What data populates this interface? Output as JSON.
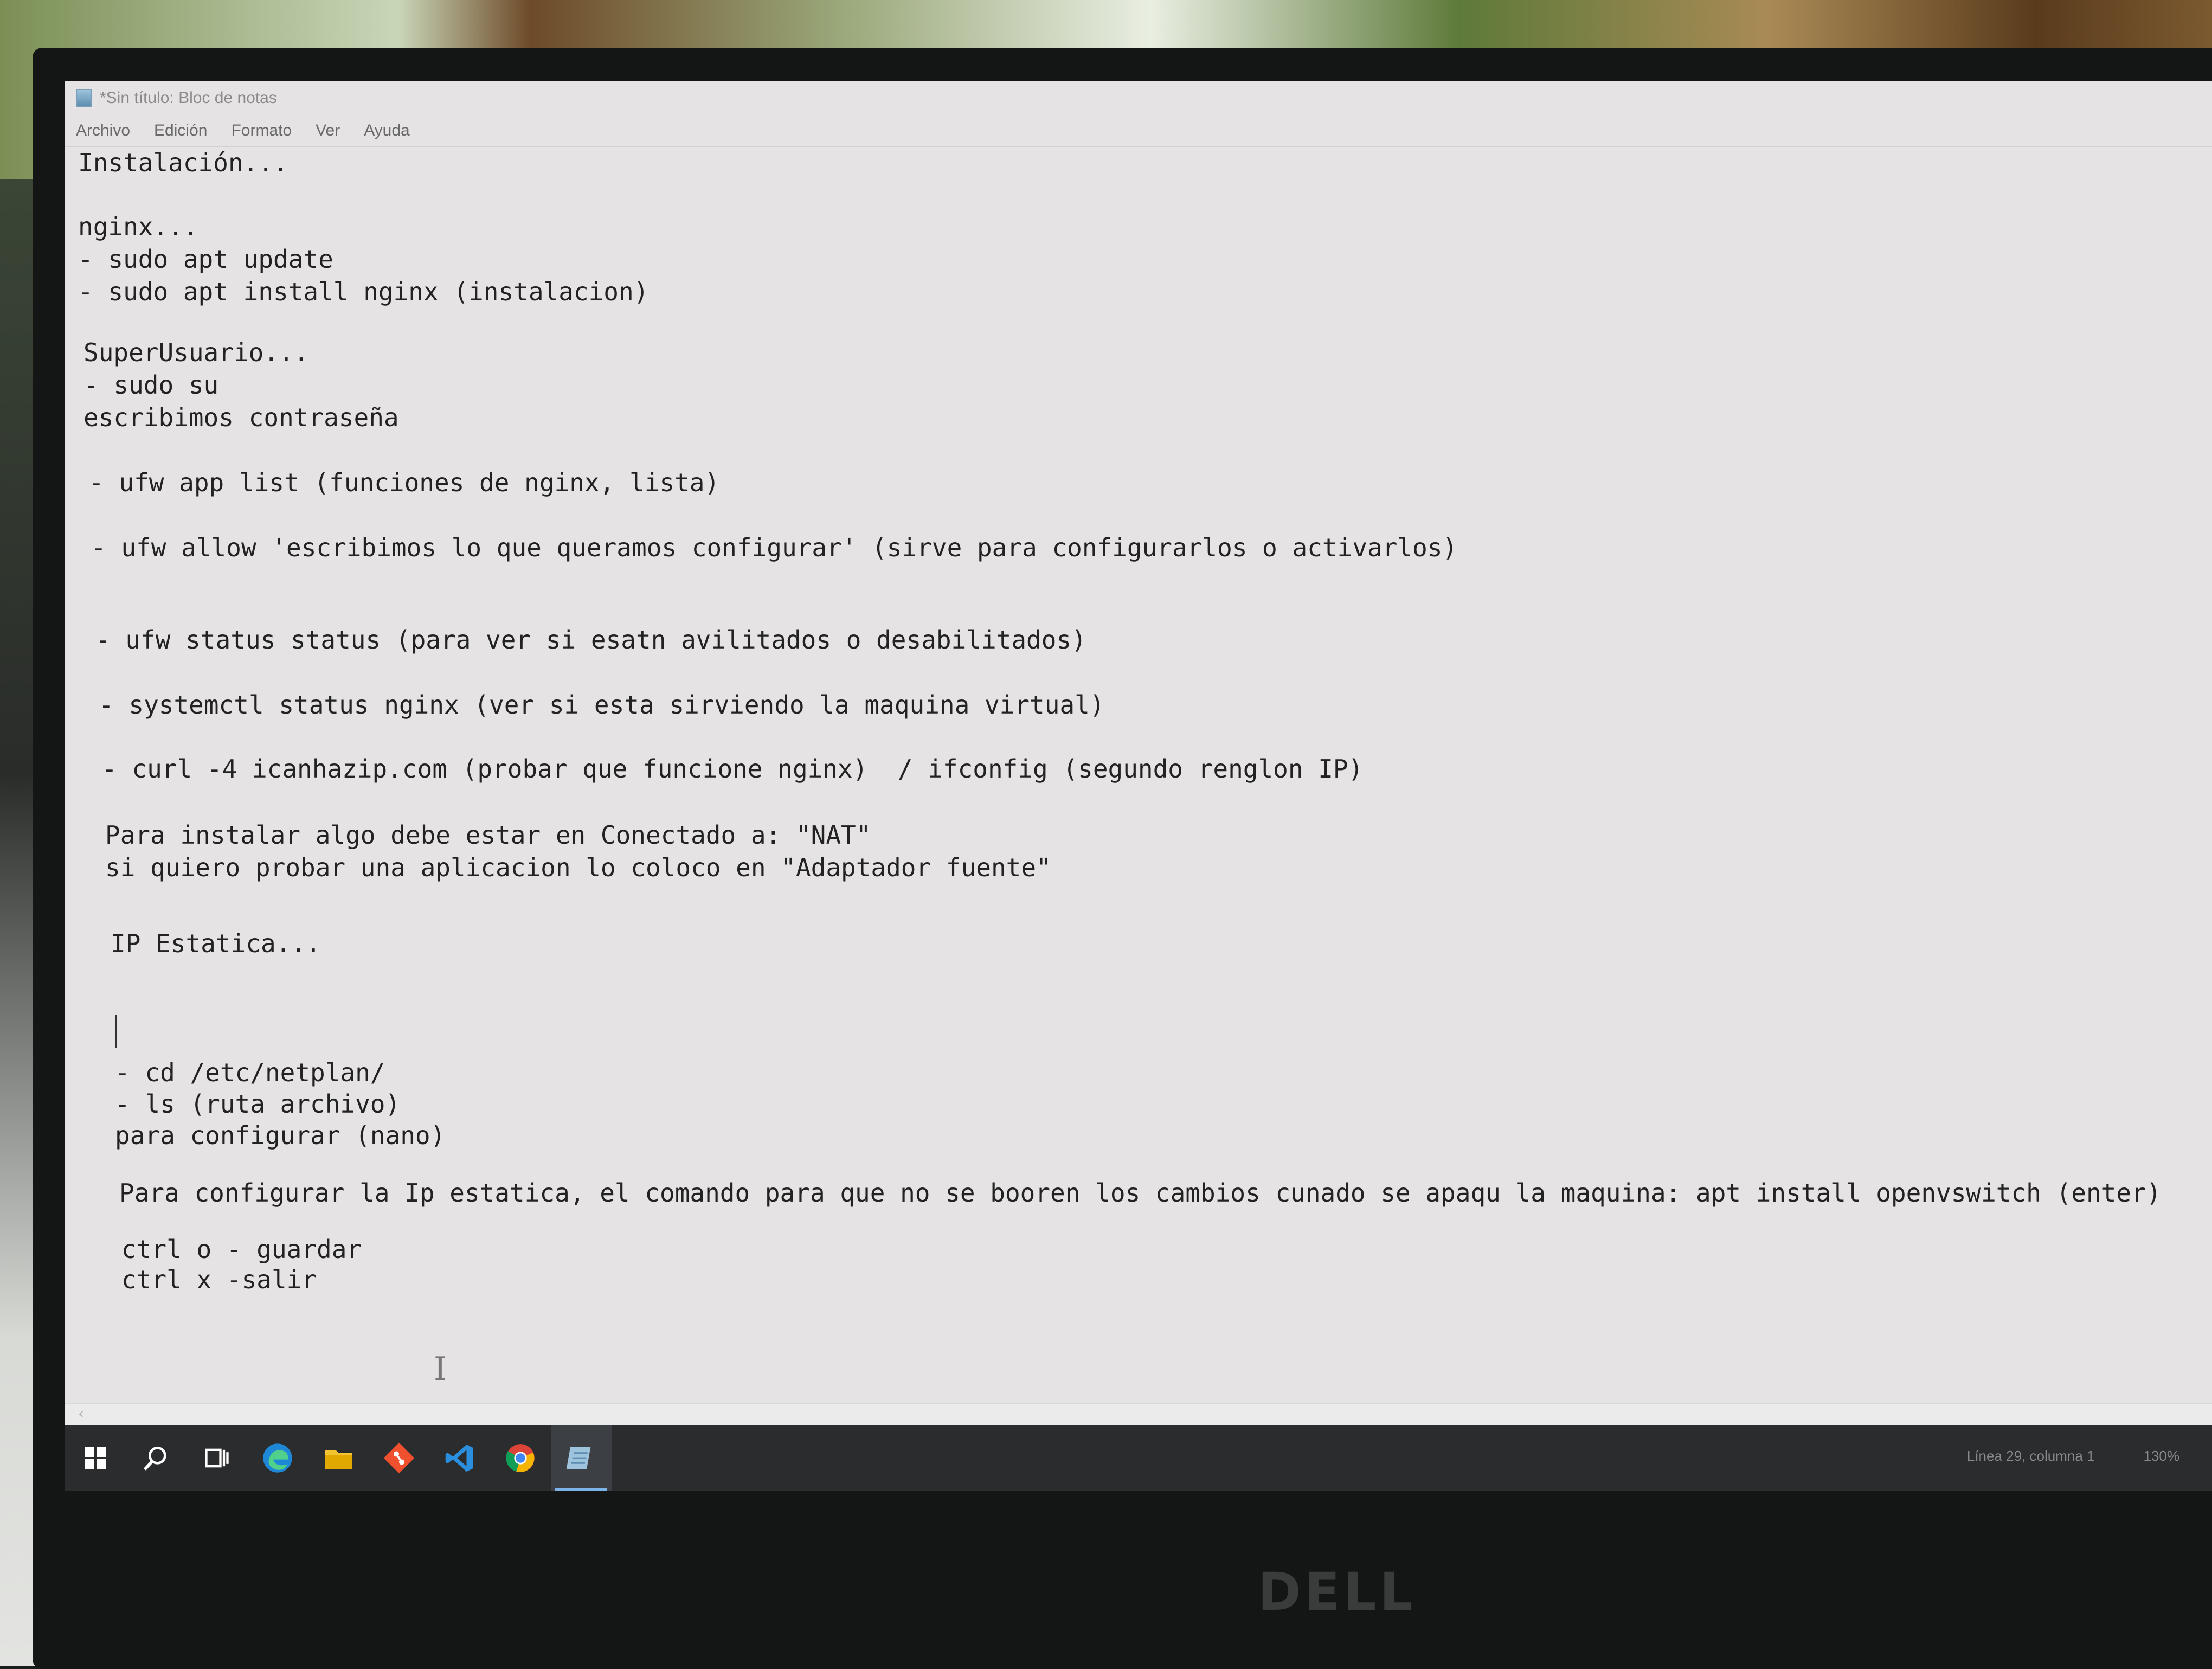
{
  "window": {
    "title": "*Sin título: Bloc de notas",
    "menu": [
      "Archivo",
      "Edición",
      "Formato",
      "Ver",
      "Ayuda"
    ]
  },
  "editor": {
    "lines": [
      "Instalación...",
      "nginx...",
      "- sudo apt update",
      "- sudo apt install nginx (instalacion)",
      "SuperUsuario...",
      "- sudo su",
      "escribimos contraseña",
      "- ufw app list (funciones de nginx, lista)",
      "- ufw allow 'escribimos lo que queramos configurar' (sirve para configurarlos o activarlos)",
      "- ufw status status (para ver si esatn avilitados o desabilitados)",
      "- systemctl status nginx (ver si esta sirviendo la maquina virtual)",
      "- curl -4 icanhazip.com (probar que funcione nginx)  / ifconfig (segundo renglon IP)",
      "Para instalar algo debe estar en Conectado a: \"NAT\"",
      "si quiero probar una aplicacion lo coloco en \"Adaptador fuente\"",
      "IP Estatica...",
      "- cd /etc/netplan/",
      "- ls (ruta archivo)",
      "para configurar (nano)",
      "Para configurar la Ip estatica, el comando para que no se booren los cambios cunado se apaqu la maquina: apt install openvswitch (enter)",
      "ctrl o - guardar",
      "ctrl x -salir"
    ]
  },
  "statusbar": {
    "position": "Línea 29, columna 1",
    "zoom": "130%"
  },
  "taskbar": {
    "icons": [
      "windows-start-icon",
      "search-icon",
      "task-view-icon",
      "edge-icon",
      "file-explorer-icon",
      "git-icon",
      "vscode-icon",
      "chrome-icon",
      "notepad-icon"
    ]
  },
  "bezel": {
    "brand": "DELL"
  },
  "colors": {
    "editor_bg": "#e6e3e4",
    "text": "#222222",
    "taskbar": "#2a2c2e",
    "taskbar_active_indicator": "#7cb4e8"
  }
}
